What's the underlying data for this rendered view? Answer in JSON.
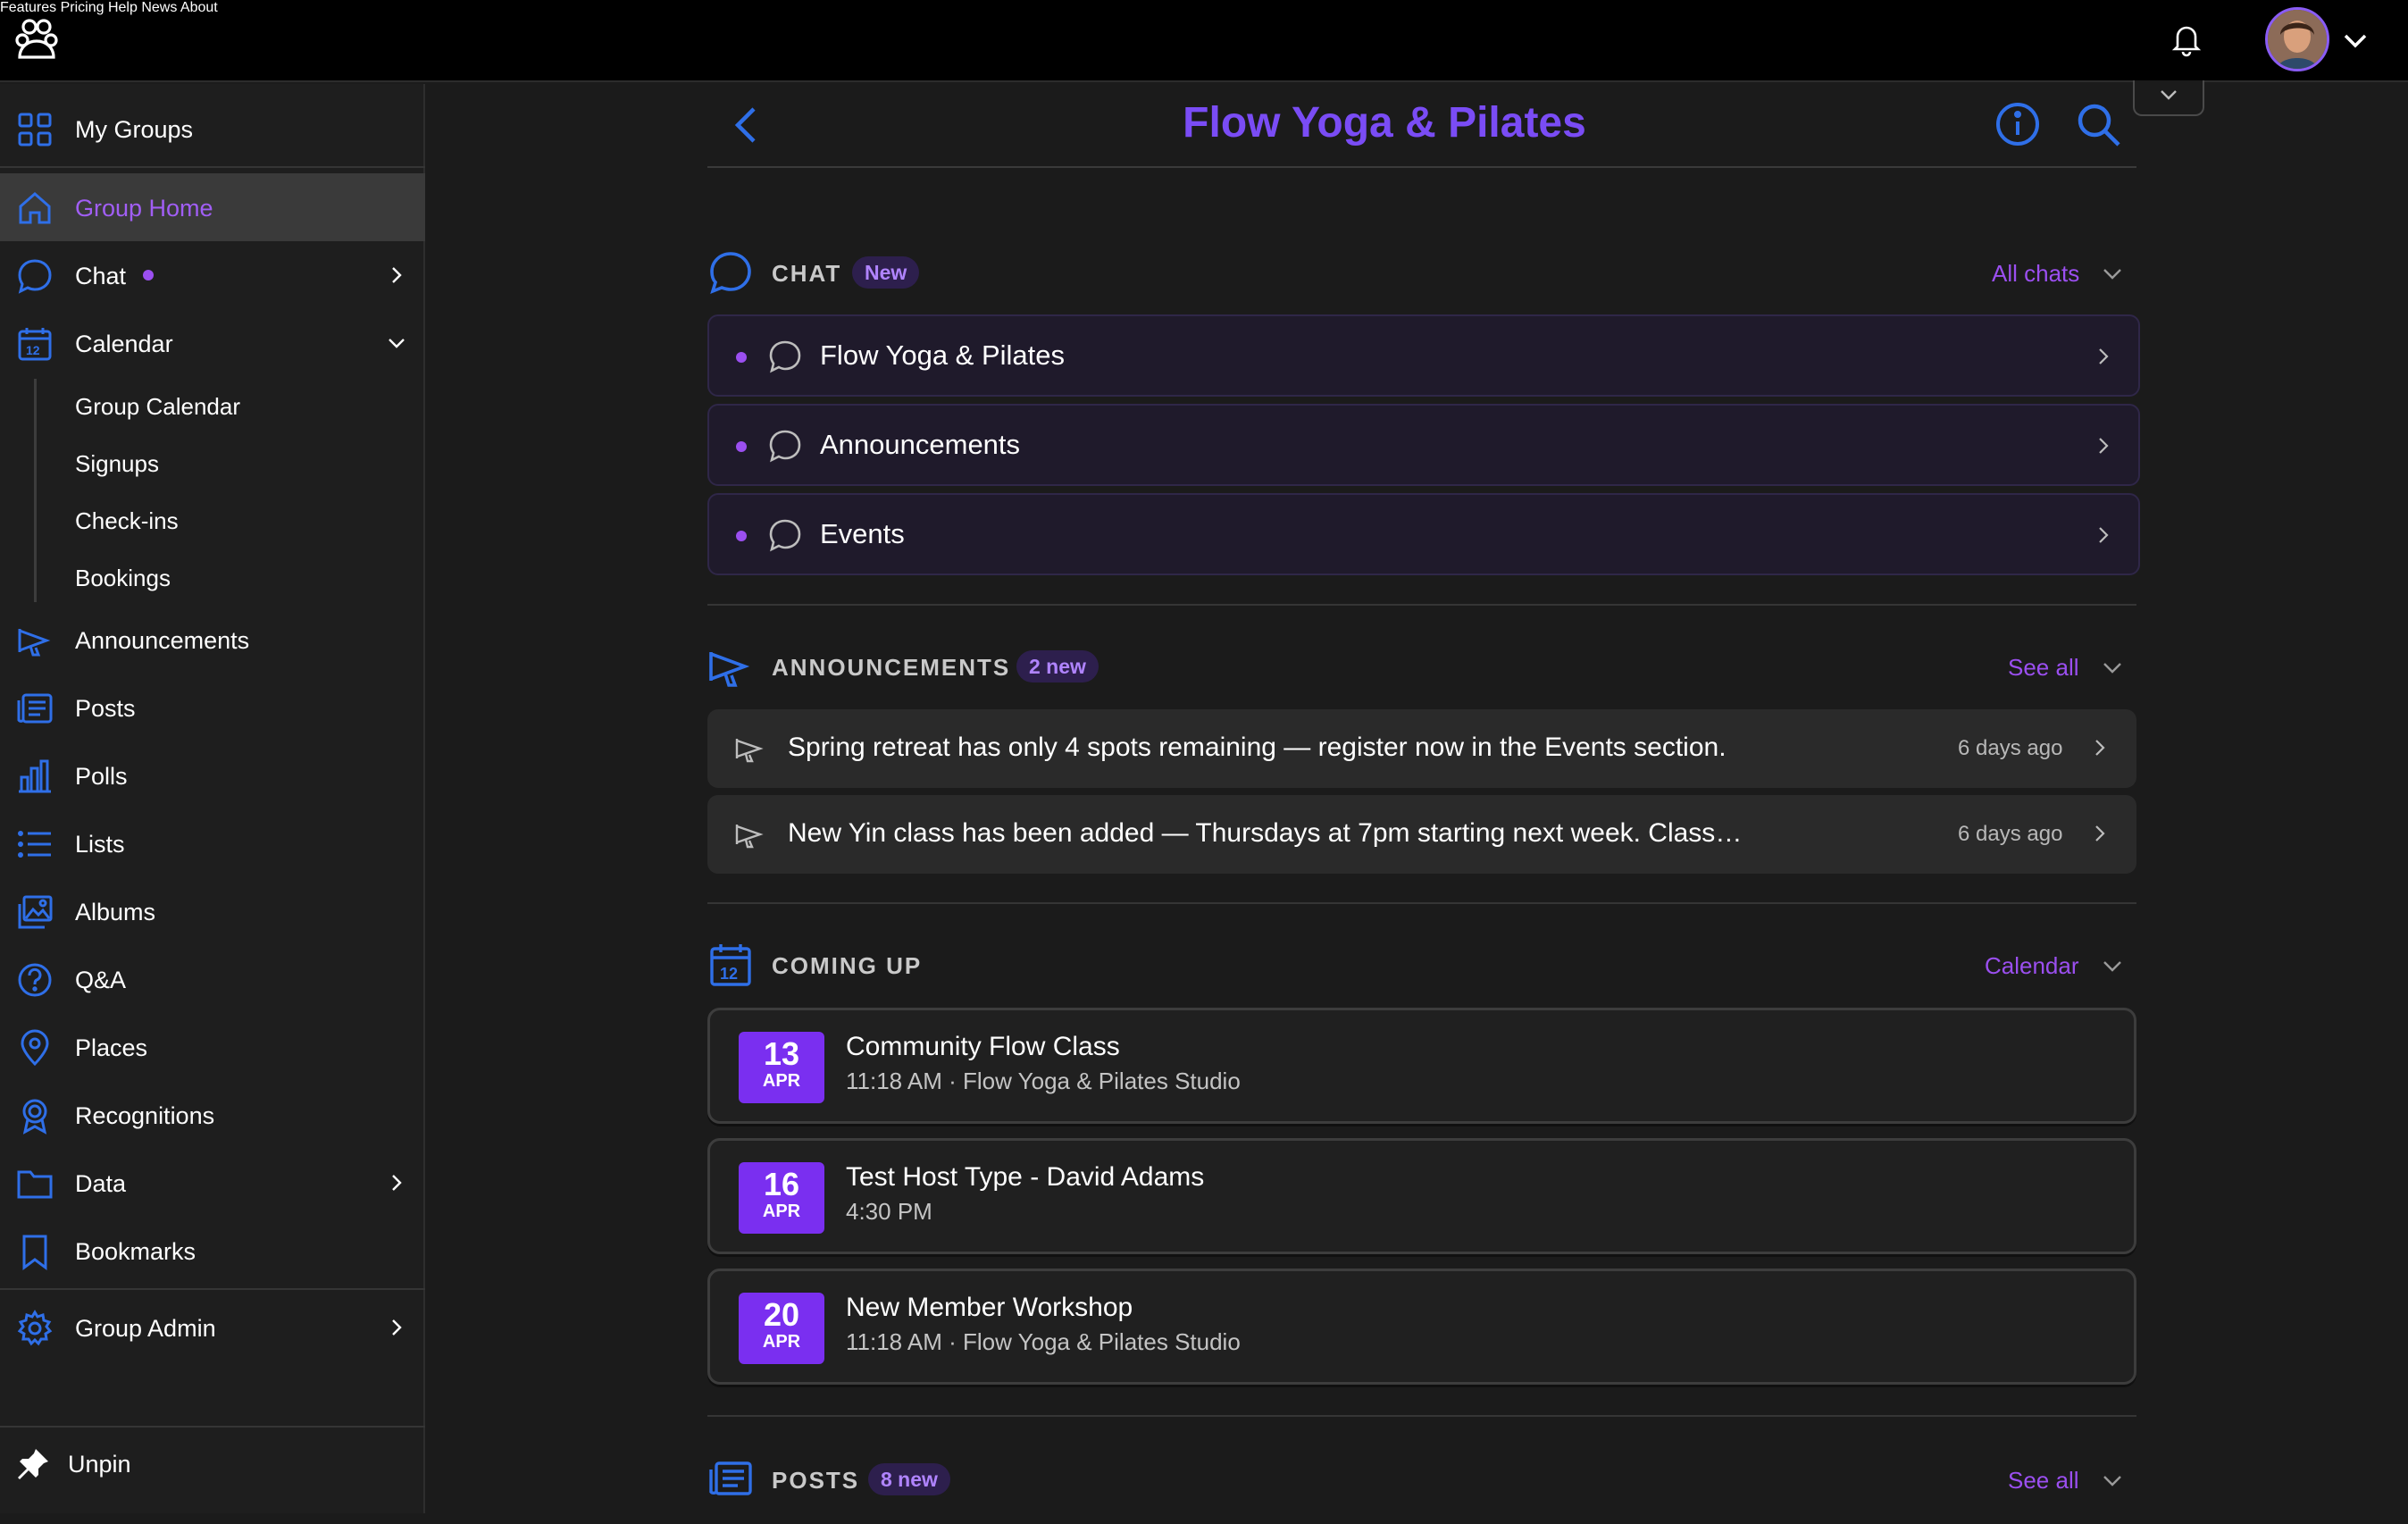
{
  "topbar": {
    "nav": [
      "Features",
      "Pricing",
      "Help",
      "News",
      "About"
    ]
  },
  "sidebar": {
    "my_groups": "My Groups",
    "group_home": "Group Home",
    "chat": "Chat",
    "calendar": "Calendar",
    "calendar_sub": [
      "Group Calendar",
      "Signups",
      "Check-ins",
      "Bookings"
    ],
    "announcements": "Announcements",
    "posts": "Posts",
    "polls": "Polls",
    "lists": "Lists",
    "albums": "Albums",
    "qa": "Q&A",
    "places": "Places",
    "recognitions": "Recognitions",
    "data": "Data",
    "bookmarks": "Bookmarks",
    "group_admin": "Group Admin",
    "unpin": "Unpin"
  },
  "header": {
    "title": "Flow Yoga & Pilates"
  },
  "chat_section": {
    "title": "CHAT",
    "badge": "New",
    "link": "All chats",
    "items": [
      "Flow Yoga & Pilates",
      "Announcements",
      "Events"
    ]
  },
  "announcements_section": {
    "title": "ANNOUNCEMENTS",
    "badge": "2 new",
    "link": "See all",
    "items": [
      {
        "text": "Spring retreat has only 4 spots remaining — register now in the Events section.",
        "time": "6 days ago"
      },
      {
        "text": "New Yin class has been added — Thursdays at 7pm starting next week. Class size is limited, please sign up early.",
        "time": "6 days ago"
      }
    ]
  },
  "coming_up_section": {
    "title": "COMING UP",
    "link": "Calendar",
    "events": [
      {
        "day": "13",
        "month": "APR",
        "title": "Community Flow Class",
        "subtitle": "11:18 AM · Flow Yoga & Pilates Studio"
      },
      {
        "day": "16",
        "month": "APR",
        "title": "Test Host Type - David Adams",
        "subtitle": "4:30 PM"
      },
      {
        "day": "20",
        "month": "APR",
        "title": "New Member Workshop",
        "subtitle": "11:18 AM · Flow Yoga & Pilates Studio"
      }
    ]
  },
  "posts_section": {
    "title": "POSTS",
    "badge": "8 new",
    "link": "See all"
  },
  "colors": {
    "accent": "#7a4cf5",
    "icon_blue": "#2f6fe8",
    "purple_dot": "#9b4ff0",
    "date_box": "#7a2ff0"
  },
  "icons": {
    "logo": "group-people-icon",
    "bell": "bell-icon",
    "back": "chevron-left-icon",
    "info": "info-icon",
    "search": "search-icon"
  }
}
